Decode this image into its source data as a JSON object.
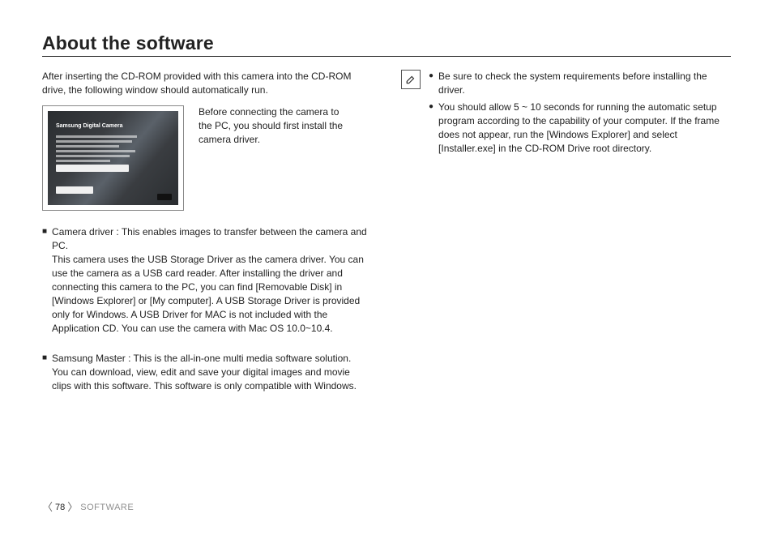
{
  "title": "About the software",
  "left": {
    "intro": "After inserting the CD-ROM provided with this camera into the CD-ROM drive, the following window should automatically run.",
    "thumb_title": "Samsung Digital Camera",
    "aside": "Before connecting the camera to the PC, you should first install the camera driver.",
    "items": [
      {
        "head": "Camera driver : This enables images to transfer between the camera and PC.",
        "body": "This camera uses the USB Storage Driver as the camera driver. You can use the camera as a USB card reader. After installing the driver and connecting this camera to the PC, you can find [Removable Disk] in [Windows Explorer] or [My computer]. A USB Storage Driver is provided only for Windows. A USB Driver for MAC is not included with the Application CD. You can use the camera with Mac OS 10.0~10.4."
      },
      {
        "head": "Samsung Master : This is the all-in-one multi media software solution.",
        "body": "You can download, view, edit and save your digital images and movie clips with this software. This software is only compatible with Windows."
      }
    ]
  },
  "right": {
    "bullets": [
      "Be sure to check the system requirements before installing the driver.",
      "You should allow 5 ~ 10 seconds for running the automatic setup program according to the capability of your computer. If the frame does not appear, run the [Windows Explorer] and select [Installer.exe] in the CD-ROM Drive root directory."
    ]
  },
  "footer": {
    "page": "78",
    "label": "SOFTWARE"
  }
}
